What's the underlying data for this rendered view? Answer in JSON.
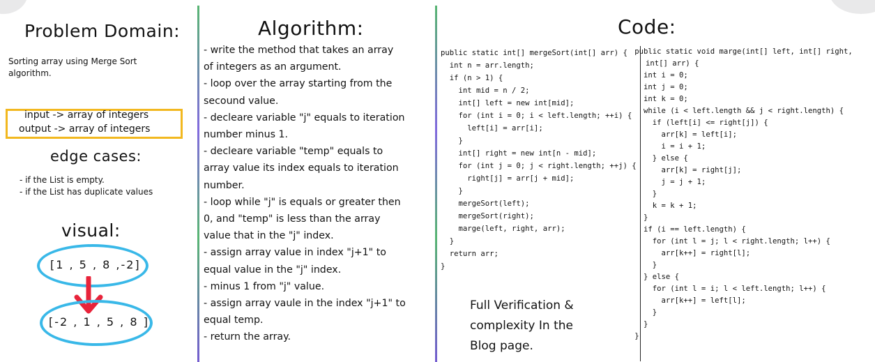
{
  "problem": {
    "title": "Problem Domain:",
    "description": "Sorting array using Merge Sort algorithm.",
    "input_line": "input -> array of integers",
    "output_line": "output -> array of integers",
    "edge_title": "edge cases:",
    "edge_cases": [
      "- if the List is empty.",
      "- if the List has duplicate values"
    ],
    "visual_title": "visual:",
    "before": "[1 , 5 , 8 ,-2]",
    "after": "[-2 , 1 , 5 , 8 ]"
  },
  "algorithm": {
    "title": "Algorithm:",
    "lines": [
      "- write the method that takes an array",
      "of integers as an argument.",
      "- loop over the array starting from the",
      "secound value.",
      "- decleare variable \"j\" equals to iteration",
      "number minus 1.",
      "- decleare variable \"temp\" equals to",
      "array value its index equals to iteration",
      "number.",
      "- loop while \"j\" is equals or greater then",
      "0, and \"temp\" is less than the array",
      "value that in the \"j\" index.",
      "- assign array value in index \"j+1\" to",
      "equal value in the \"j\" index.",
      "- minus 1 from \"j\" value.",
      "- assign array vaule in the index \"j+1\" to",
      "equal temp.",
      "- return the array."
    ]
  },
  "code": {
    "title": "Code:",
    "merge_sort": [
      "public static int[] mergeSort(int[] arr) {",
      "  int n = arr.length;",
      "  if (n > 1) {",
      "    int mid = n / 2;",
      "    int[] left = new int[mid];",
      "    for (int i = 0; i < left.length; ++i) {",
      "      left[i] = arr[i];",
      "    }",
      "    int[] right = new int[n - mid];",
      "    for (int j = 0; j < right.length; ++j) {",
      "      right[j] = arr[j + mid];",
      "    }",
      "    mergeSort(left);",
      "    mergeSort(right);",
      "    marge(left, right, arr);",
      "  }",
      "  return arr;",
      "}"
    ],
    "merge": [
      "      public static void marge(int[] left, int[] right,",
      "int[] arr) {",
      "        int i = 0;",
      "        int j = 0;",
      "        int k = 0;",
      "        while (i < left.length && j < right.length) {",
      "          if (left[i] <= right[j]) {",
      "            arr[k] = left[i];",
      "            i = i + 1;",
      "          } else {",
      "            arr[k] = right[j];",
      "            j = j + 1;",
      "          }",
      "          k = k + 1;",
      "        }",
      "        if (i == left.length) {",
      "          for (int l = j; l < right.length; l++) {",
      "            arr[k++] = right[l];",
      "          }",
      "        } else {",
      "          for (int l = i; l < left.length; l++) {",
      "            arr[k++] = left[l];",
      "          }",
      "        }",
      "      }"
    ],
    "note_lines": [
      "Full Verification &",
      "complexity In the",
      "Blog page."
    ]
  },
  "colors": {
    "box": "#f2b81f",
    "ellipse": "#39b8e8",
    "arrow": "#e8233a"
  }
}
